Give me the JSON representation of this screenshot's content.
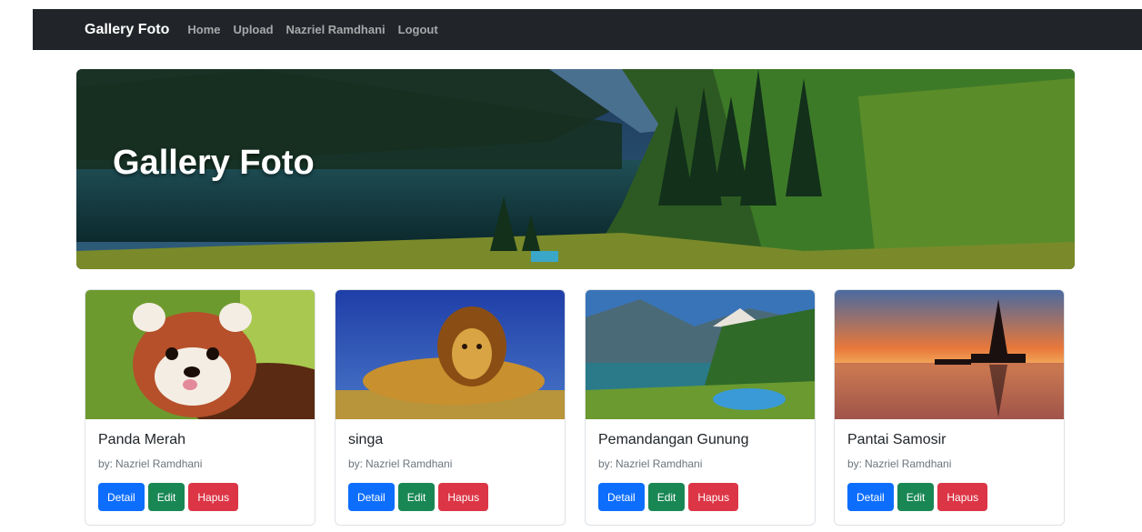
{
  "navbar": {
    "brand": "Gallery Foto",
    "links": [
      "Home",
      "Upload",
      "Nazriel Ramdhani",
      "Logout"
    ]
  },
  "hero": {
    "title": "Gallery Foto"
  },
  "cards": [
    {
      "title": "Panda Merah",
      "by_prefix": "by:",
      "author": "Nazriel Ramdhani"
    },
    {
      "title": "singa",
      "by_prefix": "by:",
      "author": "Nazriel Ramdhani"
    },
    {
      "title": "Pemandangan Gunung",
      "by_prefix": "by:",
      "author": "Nazriel Ramdhani"
    },
    {
      "title": "Pantai Samosir",
      "by_prefix": "by:",
      "author": "Nazriel Ramdhani"
    }
  ],
  "buttons": {
    "detail": "Detail",
    "edit": "Edit",
    "hapus": "Hapus"
  },
  "colors": {
    "navbar": "#212529",
    "primary": "#0d6efd",
    "success": "#198754",
    "danger": "#dc3545"
  }
}
